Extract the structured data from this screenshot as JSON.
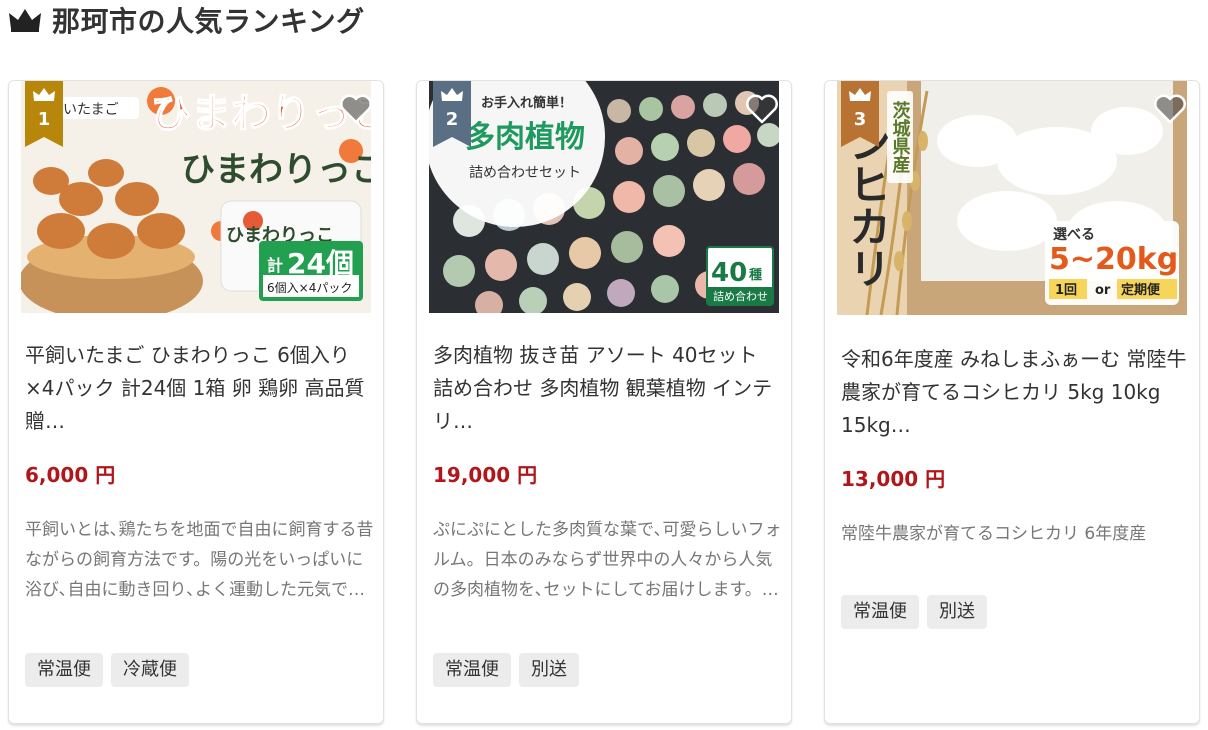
{
  "section": {
    "title": "那珂市の人気ランキング",
    "icon": "crown-icon"
  },
  "colors": {
    "rank1": "#b8860b",
    "rank2": "#5b6f84",
    "rank3": "#b87333",
    "price": "#b0161a",
    "tag_bg": "#ececec"
  },
  "cards": [
    {
      "rank": "1",
      "title": "平飼いたまご ひまわりっこ 6個入り×4パック 計24個 1箱 卵 鶏卵 高品質 贈…",
      "price": "6,000 円",
      "description": "平飼いとは､鶏たちを地面で自由に飼育する昔ながらの飼育方法です。陽の光をいっぱいに浴び､自由に動き回り､よく運動した元気で…",
      "tags": [
        "常温便",
        "冷蔵便"
      ],
      "image": {
        "brand_small": "平飼いたまご",
        "brand_big": "ひまわりっこ",
        "count_prefix": "計",
        "count": "24個",
        "pack": "6個入×4パック"
      }
    },
    {
      "rank": "2",
      "title": "多肉植物 抜き苗 アソート 40セット 詰め合わせ 多肉植物 観葉植物 インテリ…",
      "price": "19,000 円",
      "description": "ぷにぷにとした多肉質な葉で､可愛らしいフォルム。日本のみならず世界中の人々から人気の多肉植物を､セットにしてお届けします。…",
      "tags": [
        "常温便",
        "別送"
      ],
      "image": {
        "top": "お手入れ簡単！",
        "main": "多肉植物",
        "sub": "詰め合わせセット",
        "badge_num": "40",
        "badge_unit": "種",
        "badge_sub": "詰め合わせ"
      }
    },
    {
      "rank": "3",
      "title": "令和6年度産 みねしまふぁーむ 常陸牛農家が育てるコシヒカリ 5kg 10kg 15kg…",
      "price": "13,000 円",
      "description": "常陸牛農家が育てるコシヒカリ 6年度産",
      "tags": [
        "常温便",
        "別送"
      ],
      "image": {
        "origin": "茨城県産",
        "variety": "ンヒカリ",
        "choose": "選べる",
        "weight": "5~20kg",
        "opt1": "1回",
        "or": "or",
        "opt2": "定期便"
      }
    }
  ]
}
